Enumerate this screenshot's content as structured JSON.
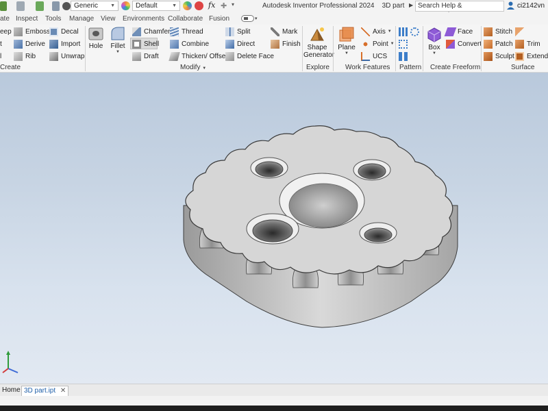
{
  "title_bar": {
    "app_title": "Autodesk Inventor Professional 2024",
    "doc_title": "3D part",
    "material_value": "Generic",
    "appearance_value": "Default",
    "search_placeholder": "Search Help & Commands...",
    "username": "ci2142vn",
    "fx_label": "fx"
  },
  "menu_tabs": [
    "ate",
    "Inspect",
    "Tools",
    "Manage",
    "View",
    "Environments",
    "Collaborate",
    "Fusion"
  ],
  "ribbon": {
    "create": {
      "label": "Create",
      "items": [
        "eep",
        "t",
        "l"
      ],
      "items2": [
        "Emboss",
        "Derive",
        "Rib"
      ],
      "items3": [
        "Decal",
        "Import",
        "Unwrap"
      ]
    },
    "modify": {
      "label": "Modify",
      "hole": "Hole",
      "fillet": "Fillet",
      "col1": [
        "Chamfer",
        "Shell",
        "Draft"
      ],
      "col2": [
        "Thread",
        "Combine",
        "Thicken/ Offset"
      ],
      "col3": [
        "Split",
        "Direct",
        "Delete Face"
      ],
      "col4": [
        "Mark",
        "Finish"
      ]
    },
    "explore": {
      "label": "Explore",
      "shape_generator": "Shape\nGenerator"
    },
    "work_features": {
      "label": "Work Features",
      "plane": "Plane",
      "axis": "Axis",
      "point": "Point",
      "ucs": "UCS"
    },
    "pattern": {
      "label": "Pattern"
    },
    "freeform": {
      "label": "Create Freeform",
      "box": "Box",
      "face": "Face",
      "convert": "Convert"
    },
    "surface": {
      "label": "Surface",
      "items": [
        "Stitch",
        "Patch",
        "Sculpt"
      ],
      "items2": [
        "Trim",
        "Extend"
      ]
    }
  },
  "doc_tabs": {
    "home": "Home",
    "active": "3D part.ipt",
    "close": "✕"
  },
  "colors": {
    "accent_blue": "#2b6cb0",
    "viewport_top": "#b9c9dc",
    "viewport_bottom": "#e2e9f2",
    "part_gray": "#d4d4d4"
  },
  "icons": [
    "save-icon",
    "undo-icon",
    "redo-icon",
    "material-icon",
    "appearance-icon",
    "user-icon",
    "hole-icon",
    "fillet-icon",
    "shell-icon",
    "box-icon",
    "plane-icon",
    "shape-generator-icon",
    "view-triad-icon"
  ]
}
